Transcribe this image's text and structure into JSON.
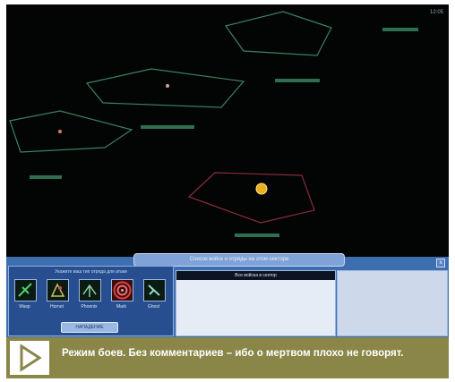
{
  "hud": {
    "corner_text": "12:05"
  },
  "panel": {
    "title": "Список войск и отряды на этом секторе",
    "close_label": "x",
    "left_caption": "Укажите ваш тип отряда для атаки",
    "units": [
      {
        "label": "Wasp",
        "icon": "wasp-unit-icon"
      },
      {
        "label": "Hornet",
        "icon": "hornet-unit-icon"
      },
      {
        "label": "Phoenix",
        "icon": "phoenix-unit-icon"
      },
      {
        "label": "Mark",
        "icon": "target-unit-icon"
      },
      {
        "label": "Ghost",
        "icon": "ghost-unit-icon"
      }
    ],
    "left_button": "НАПАДЕНИЕ",
    "list_header": "Все войска в сектор"
  },
  "caption": {
    "text": "Режим боев. Без комментариев – ибо о мертвом плохо не говорят.",
    "background": "#898648"
  },
  "colors": {
    "sector_green": "#3f7f63",
    "sector_red": "#8a2a3c",
    "panel_blue": "#3d6fb0"
  }
}
